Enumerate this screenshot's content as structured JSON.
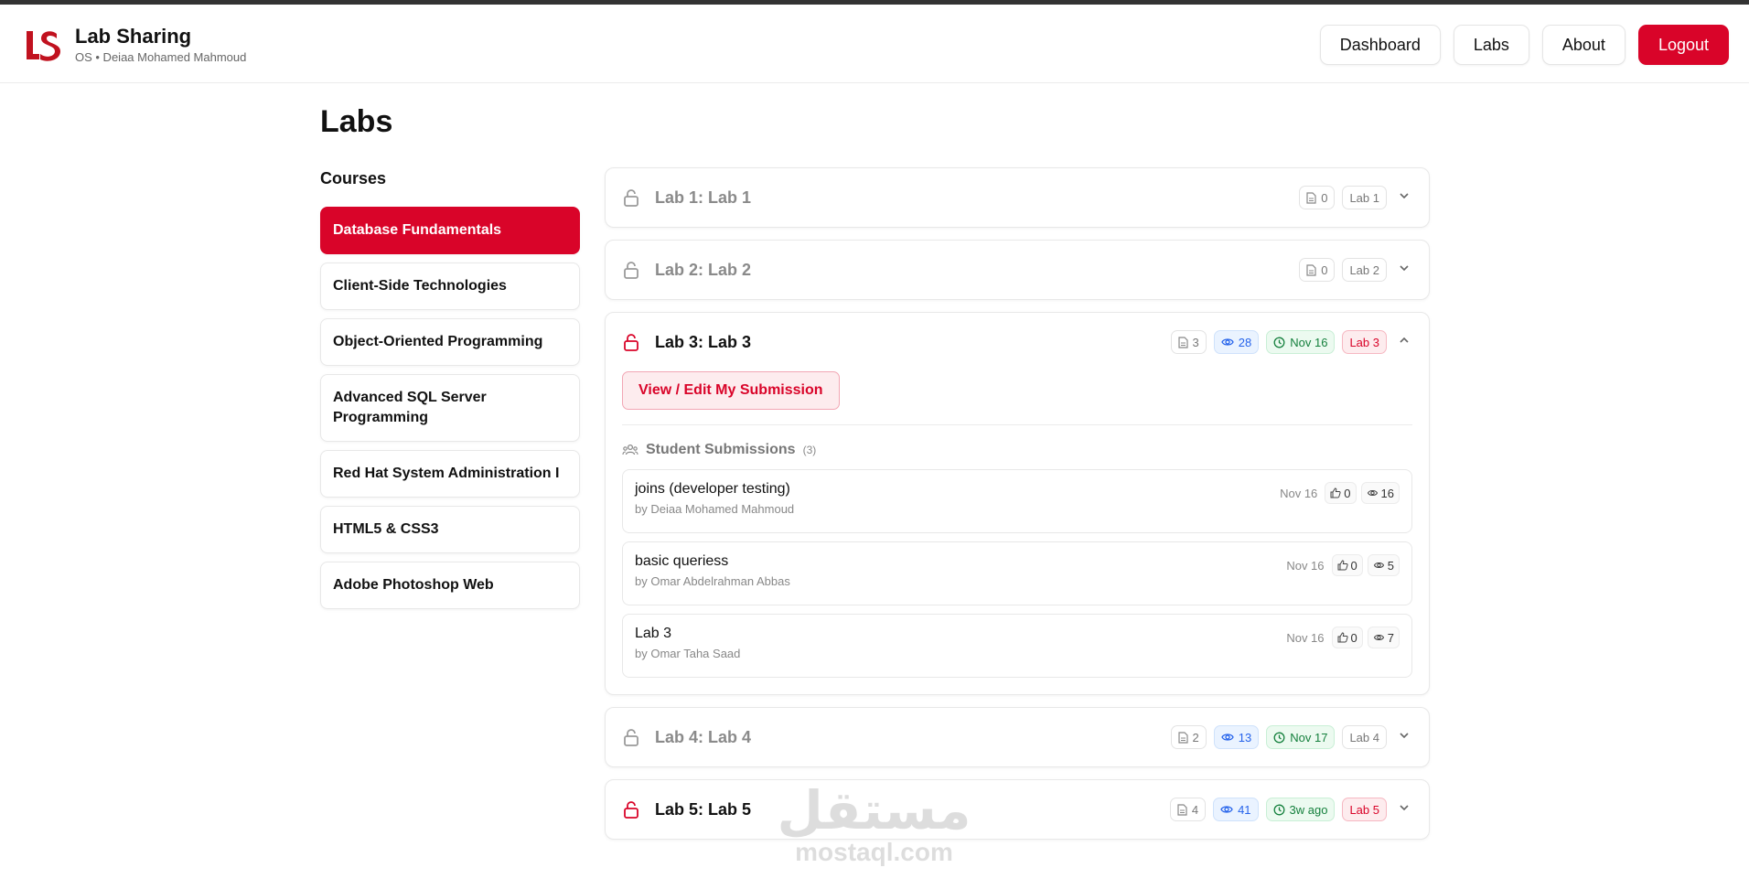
{
  "header": {
    "logo_text": "LS",
    "title": "Lab Sharing",
    "subtitle": "OS • Deiaa Mohamed Mahmoud",
    "nav": [
      {
        "label": "Dashboard"
      },
      {
        "label": "Labs"
      },
      {
        "label": "About"
      },
      {
        "label": "Logout"
      }
    ]
  },
  "page": {
    "title": "Labs"
  },
  "courses": {
    "title": "Courses",
    "items": [
      {
        "label": "Database Fundamentals",
        "active": true
      },
      {
        "label": "Client-Side Technologies"
      },
      {
        "label": "Object-Oriented Programming"
      },
      {
        "label": "Advanced SQL Server Programming"
      },
      {
        "label": "Red Hat System Administration I"
      },
      {
        "label": "HTML5 & CSS3"
      },
      {
        "label": "Adobe Photoshop Web"
      }
    ]
  },
  "labs": [
    {
      "title": "Lab 1: Lab 1",
      "files": "0",
      "tag": "Lab 1"
    },
    {
      "title": "Lab 2: Lab 2",
      "files": "0",
      "tag": "Lab 2"
    },
    {
      "title": "Lab 3: Lab 3",
      "files": "3",
      "views": "28",
      "date": "Nov 16",
      "tag": "Lab 3",
      "edit_label": "View / Edit My Submission",
      "subs_title": "Student Submissions",
      "subs_count": "(3)",
      "submissions": [
        {
          "title": "joins (developer testing)",
          "by": "by Deiaa Mohamed Mahmoud",
          "date": "Nov 16",
          "likes": "0",
          "views": "16"
        },
        {
          "title": "basic queriess",
          "by": "by Omar Abdelrahman Abbas",
          "date": "Nov 16",
          "likes": "0",
          "views": "5"
        },
        {
          "title": "Lab 3",
          "by": "by Omar Taha Saad",
          "date": "Nov 16",
          "likes": "0",
          "views": "7"
        }
      ]
    },
    {
      "title": "Lab 4: Lab 4",
      "files": "2",
      "views": "13",
      "date": "Nov 17",
      "tag": "Lab 4"
    },
    {
      "title": "Lab 5: Lab 5",
      "files": "4",
      "views": "41",
      "date": "3w ago",
      "tag": "Lab 5"
    }
  ],
  "watermark": {
    "arabic": "مستقل",
    "latin": "mostaql.com"
  },
  "colors": {
    "accent": "#d90429",
    "views": "#2563eb",
    "date": "#15803d"
  }
}
